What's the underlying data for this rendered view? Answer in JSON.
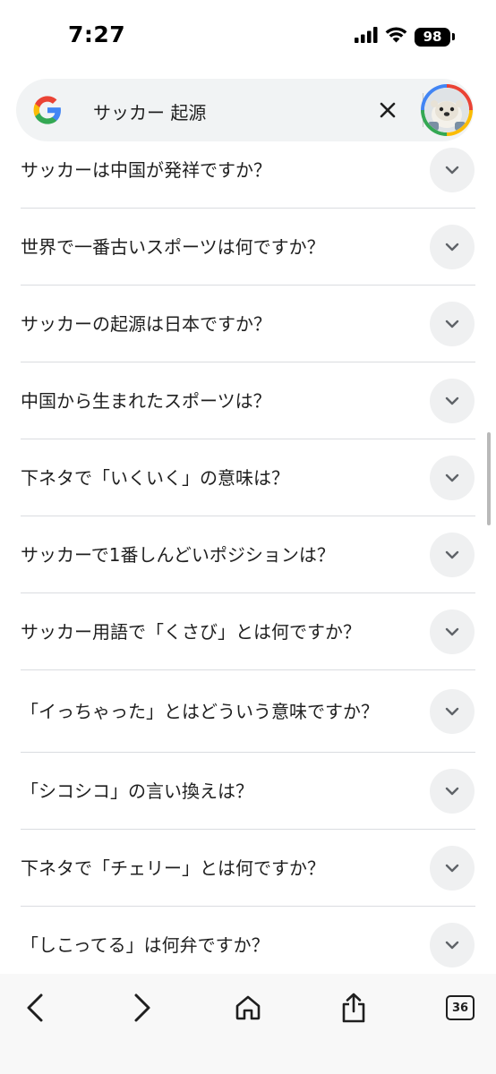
{
  "status_bar": {
    "time": "7:27",
    "battery": "98",
    "icons": [
      "cellular-signal-icon",
      "wifi-icon",
      "battery-icon"
    ]
  },
  "search": {
    "query": "サッカー 起源",
    "logo": "google-g-icon",
    "clear_icon": "close-icon",
    "avatar": "avatar-sea-otter"
  },
  "faq": [
    {
      "question": "サッカーは中国が発祥ですか？"
    },
    {
      "question": "世界で一番古いスポーツは何ですか？"
    },
    {
      "question": "サッカーの起源は日本ですか？"
    },
    {
      "question": "中国から生まれたスポーツは？"
    },
    {
      "question": "下ネタで「いくいく」の意味は？"
    },
    {
      "question": "サッカーで1番しんどいポジションは？"
    },
    {
      "question": "サッカー用語で「くさび」とは何ですか？"
    },
    {
      "question": "「イっちゃった」とはどういう意味ですか？"
    },
    {
      "question": "「シコシコ」の言い換えは？"
    },
    {
      "question": "下ネタで「チェリー」とは何ですか？"
    },
    {
      "question": "「しこってる」は何弁ですか？"
    }
  ],
  "toolbar": {
    "tab_count": "36",
    "icons": [
      "back-arrow-icon",
      "forward-arrow-icon",
      "home-icon",
      "share-icon",
      "tabs-icon"
    ]
  },
  "colors": {
    "search_bg": "#f1f3f4",
    "toggle_bg": "#eff0f1",
    "divider": "#dadce0",
    "text": "#1f1f1f",
    "google_red": "#ea4335",
    "google_yellow": "#fbbc05",
    "google_green": "#34a853",
    "google_blue": "#4285f4"
  }
}
